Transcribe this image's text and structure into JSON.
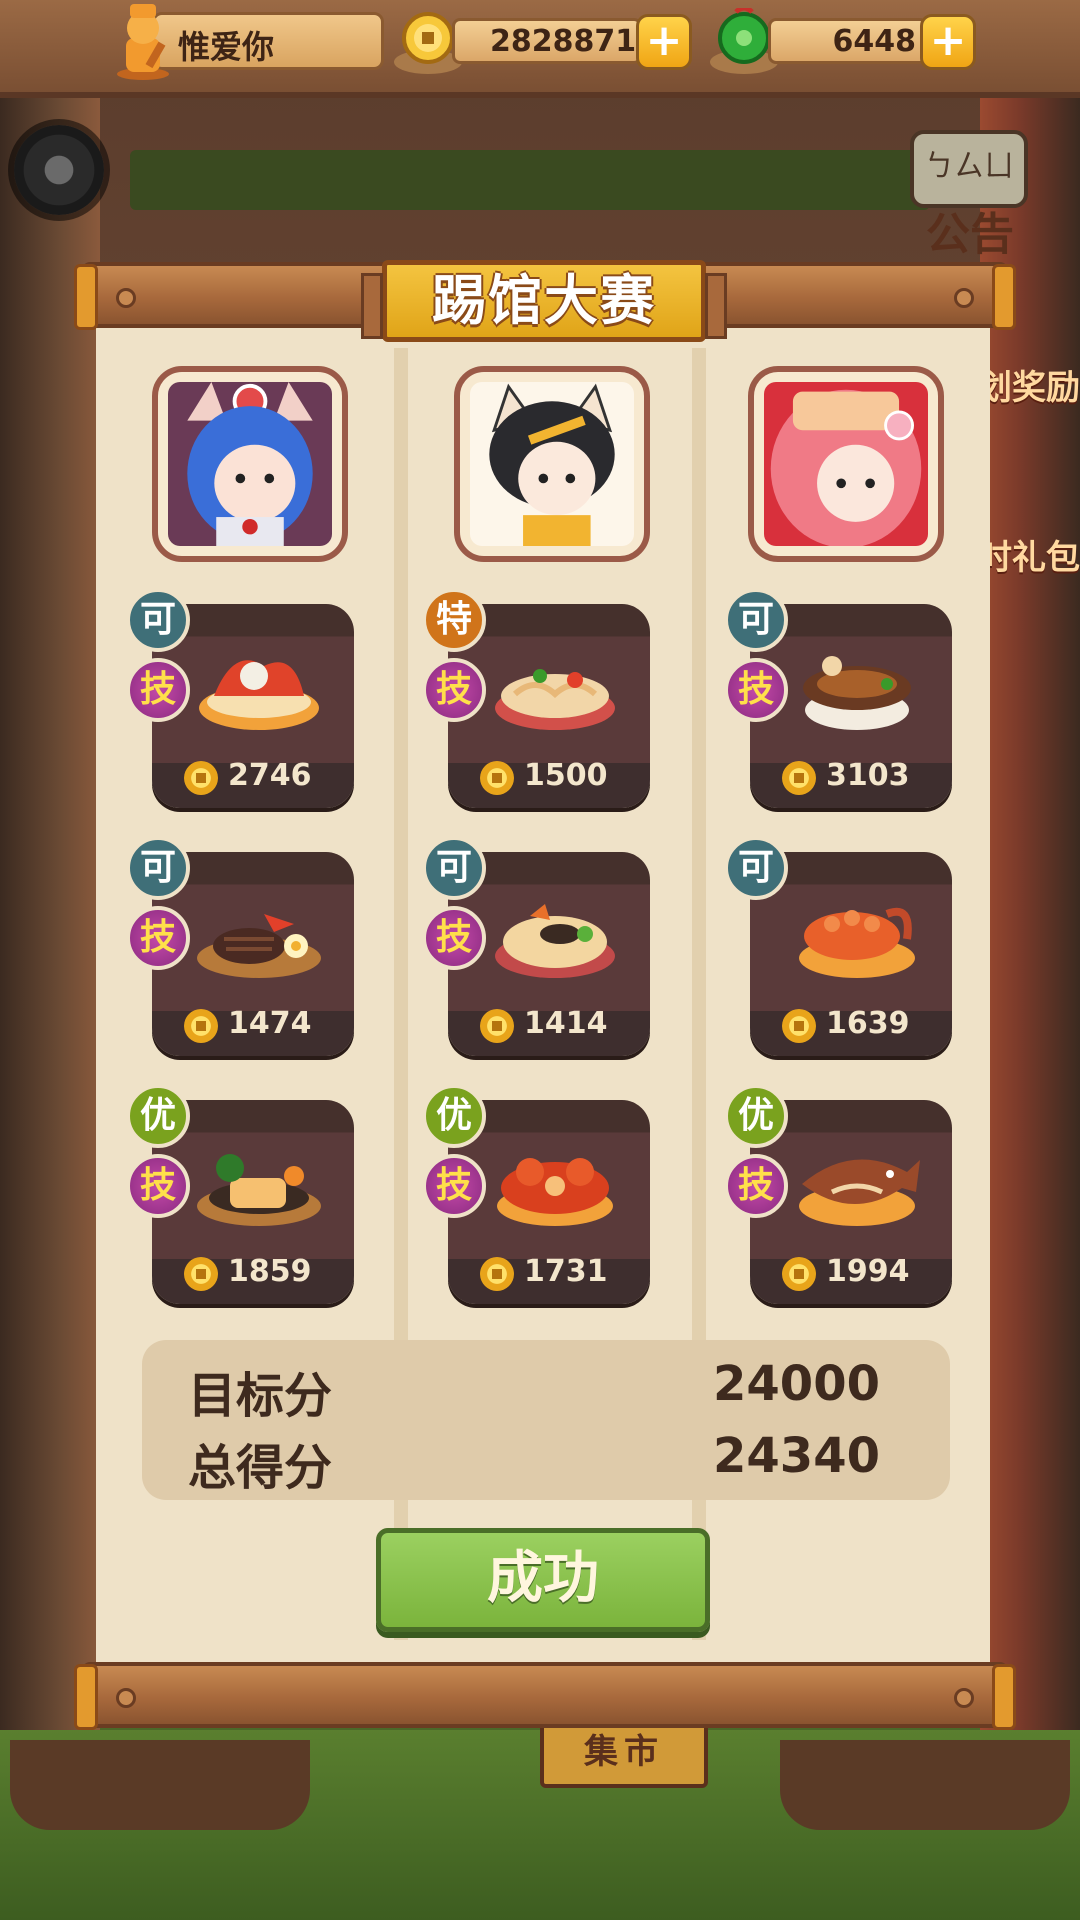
{
  "topbar": {
    "player_name": "惟爱你",
    "coins": "2828871",
    "gems": "6448",
    "add_label": "+"
  },
  "background": {
    "notice_sign": "ㄅㄙㄩ",
    "notice_label": "公告",
    "side_rewards": "划奖励",
    "side_gift": "时礼包",
    "market": "集市"
  },
  "dialog": {
    "title": "踢馆大赛",
    "columns": [
      {
        "portrait": "blue-hair-cat-ear-chef",
        "dishes": [
          {
            "grade": "可",
            "grade_color": "#3f6f78",
            "skill": "技",
            "food": "lobster-dish",
            "price": "2746"
          },
          {
            "grade": "可",
            "grade_color": "#3f6f78",
            "skill": "技",
            "food": "steak-dish",
            "price": "1474"
          },
          {
            "grade": "优",
            "grade_color": "#7aa21e",
            "skill": "技",
            "food": "salmon-dish",
            "price": "1859"
          }
        ]
      },
      {
        "portrait": "black-hair-cat-ear-chef",
        "dishes": [
          {
            "grade": "特",
            "grade_color": "#d0741a",
            "skill": "技",
            "food": "noodle-dish",
            "price": "1500"
          },
          {
            "grade": "可",
            "grade_color": "#3f6f78",
            "skill": "技",
            "food": "fried-rice-dish",
            "price": "1414"
          },
          {
            "grade": "优",
            "grade_color": "#7aa21e",
            "skill": "技",
            "food": "crab-dish",
            "price": "1731"
          }
        ]
      },
      {
        "portrait": "pink-hair-flower-chef",
        "dishes": [
          {
            "grade": "可",
            "grade_color": "#3f6f78",
            "skill": "技",
            "food": "soup-pot-dish",
            "price": "3103"
          },
          {
            "grade": "可",
            "grade_color": "#3f6f78",
            "skill": null,
            "food": "shrimp-dish",
            "price": "1639"
          },
          {
            "grade": "优",
            "grade_color": "#7aa21e",
            "skill": "技",
            "food": "fish-dish",
            "price": "1994"
          }
        ]
      }
    ],
    "target_label": "目标分",
    "target_value": "24000",
    "total_label": "总得分",
    "total_value": "24340",
    "result_button": "成功"
  },
  "colors": {
    "panel": "#efe2c8",
    "rail": "#a8693c",
    "title_gold": "#f4c440",
    "button_green": "#8cc24e",
    "skill_purple": "#a83a96"
  }
}
